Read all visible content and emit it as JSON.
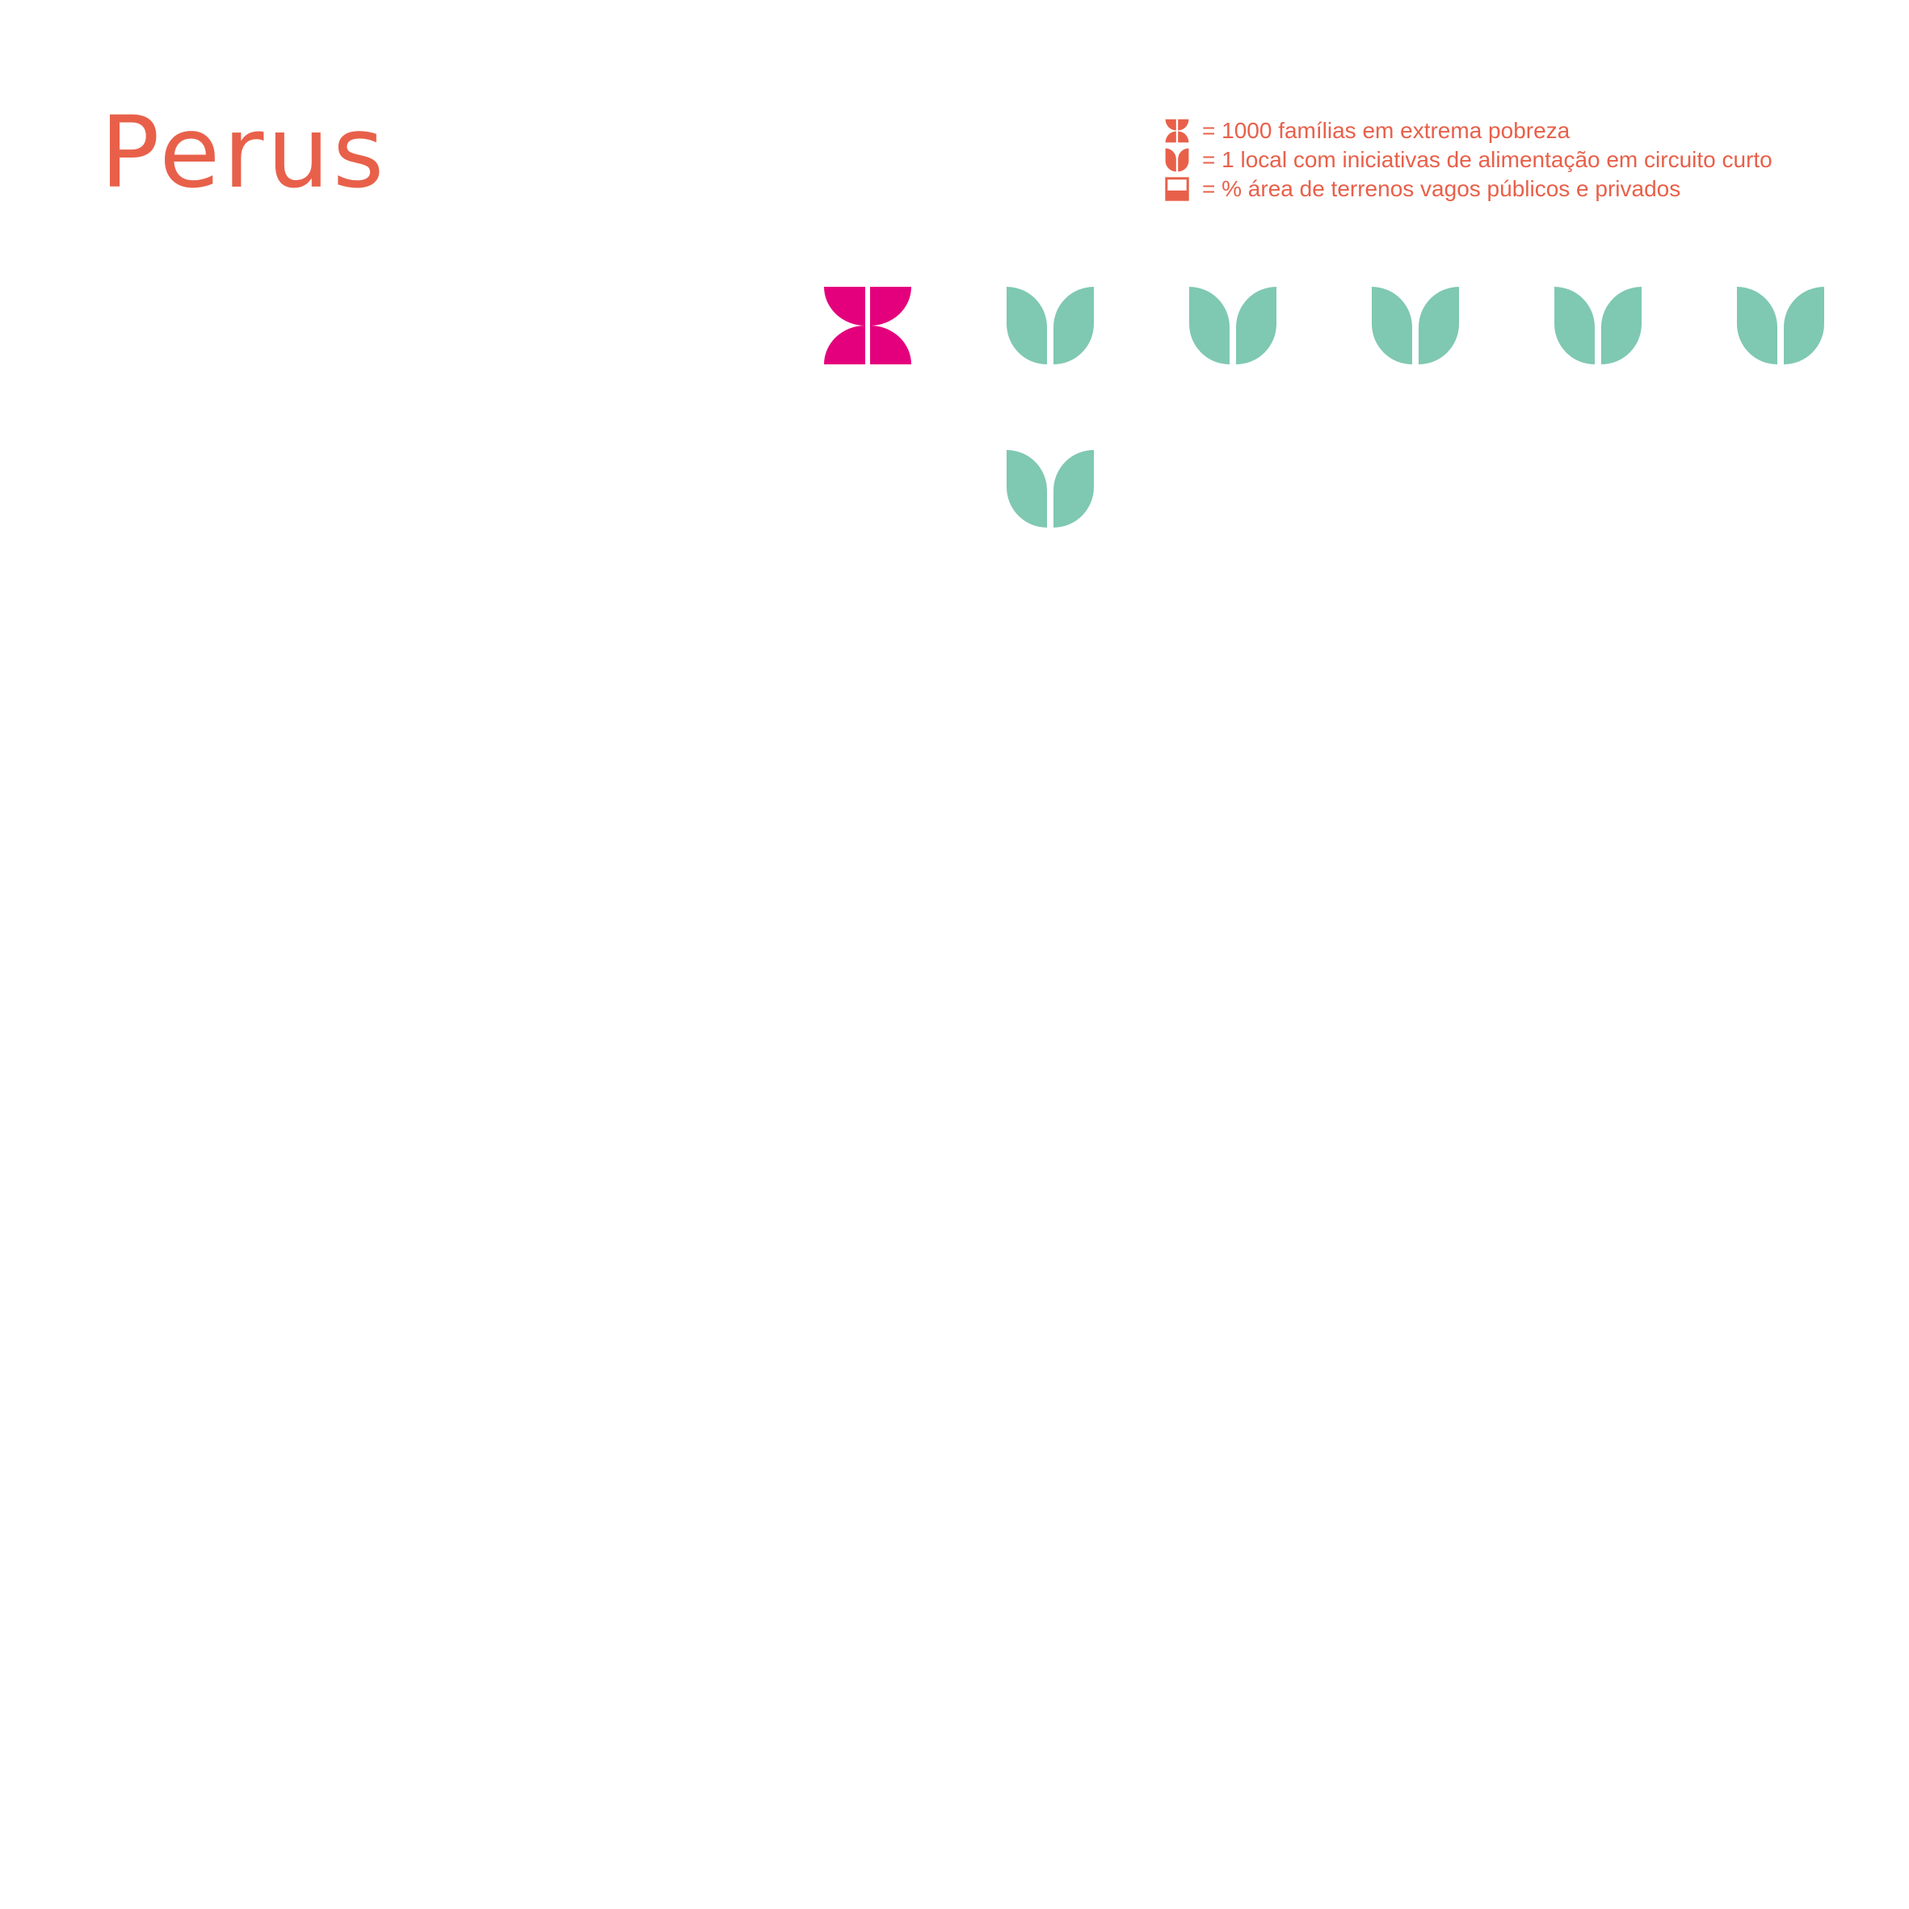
{
  "colors": {
    "text": "#e8604a",
    "poverty": "#e4007c",
    "food": "#7fc8b2",
    "legend_icon": "#e8604a"
  },
  "title": "Perus",
  "legend": {
    "items": [
      {
        "icon": "flower-icon",
        "text": "= 1000 famílias em extrema pobreza"
      },
      {
        "icon": "leaf-icon",
        "text": "= 1 local com iniciativas de alimentação em circuito curto"
      },
      {
        "icon": "square-icon",
        "text": "= % área de terrenos vagos públicos e privados"
      }
    ]
  },
  "chart_data": {
    "type": "pictogram",
    "title": "Perus",
    "series": [
      {
        "name": "1000 famílias em extrema pobreza",
        "values": [
          1
        ]
      },
      {
        "name": "1 local com iniciativas de alimentação em circuito curto",
        "values": [
          6
        ]
      }
    ],
    "area_percent_vacant_land": null
  }
}
